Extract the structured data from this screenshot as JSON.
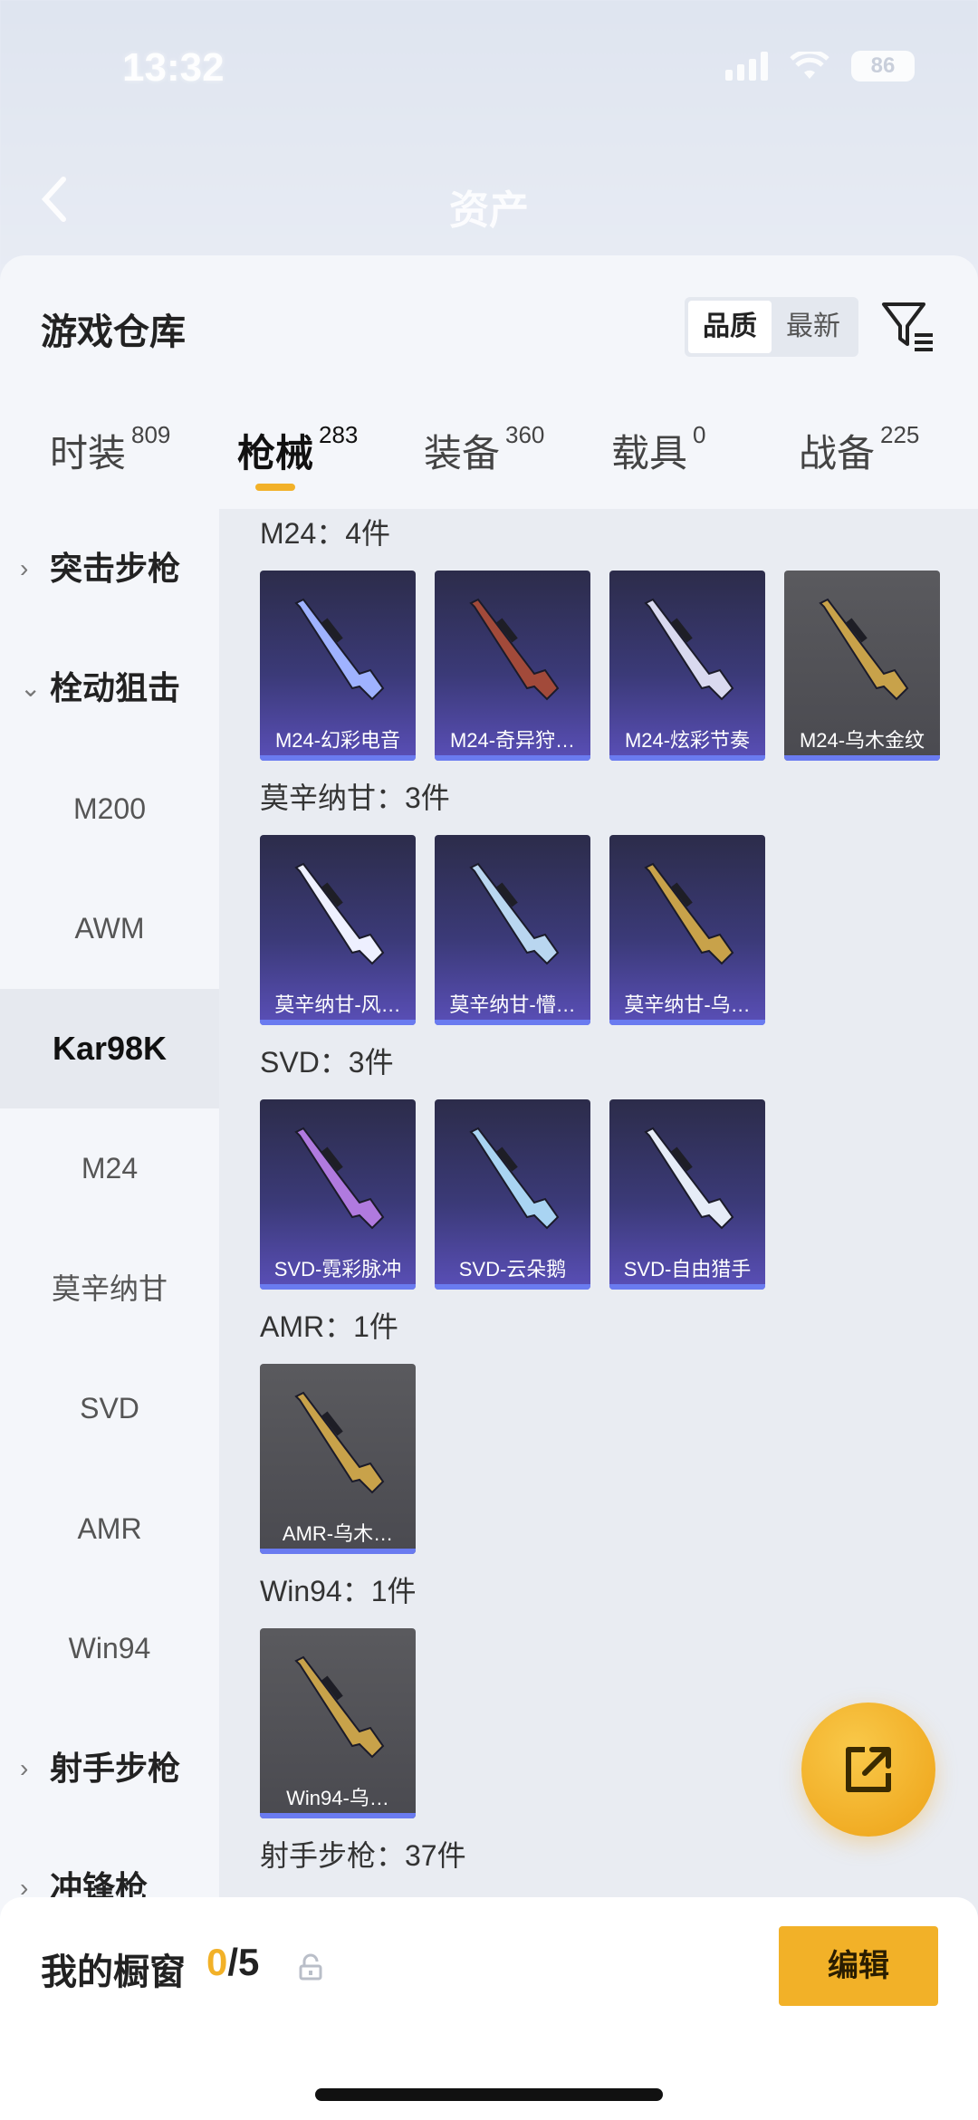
{
  "status": {
    "time": "13:32",
    "battery": "86"
  },
  "nav": {
    "title": "资产"
  },
  "sheet": {
    "title": "游戏仓库",
    "sort": {
      "options": [
        "品质",
        "最新"
      ],
      "active": "品质"
    }
  },
  "tabs": [
    {
      "label": "时装",
      "count": "809"
    },
    {
      "label": "枪械",
      "count": "283"
    },
    {
      "label": "装备",
      "count": "360"
    },
    {
      "label": "载具",
      "count": "0"
    },
    {
      "label": "战备",
      "count": "225"
    }
  ],
  "sidenav": {
    "items": [
      {
        "label": "突击步枪",
        "type": "group",
        "chev": "›"
      },
      {
        "label": "栓动狙击",
        "type": "group",
        "chev": "⌄"
      },
      {
        "label": "M200"
      },
      {
        "label": "AWM"
      },
      {
        "label": "Kar98K",
        "selected": true
      },
      {
        "label": "M24"
      },
      {
        "label": "莫辛纳甘"
      },
      {
        "label": "SVD"
      },
      {
        "label": "AMR"
      },
      {
        "label": "Win94"
      },
      {
        "label": "射手步枪",
        "type": "group",
        "chev": "›"
      },
      {
        "label": "冲锋枪",
        "type": "group",
        "chev": "›"
      }
    ]
  },
  "sections": [
    {
      "title": "M24：4件",
      "items": [
        {
          "name": "M24-幻彩电音",
          "style": "purple",
          "gun_color": "#9fb2ff"
        },
        {
          "name": "M24-奇异狩…",
          "style": "purple",
          "gun_color": "#a24a3a"
        },
        {
          "name": "M24-炫彩节奏",
          "style": "purple",
          "gun_color": "#d9d9ef"
        },
        {
          "name": "M24-乌木金纹",
          "style": "gray",
          "gun_color": "#c8a24a"
        }
      ]
    },
    {
      "title": "莫辛纳甘：3件",
      "items": [
        {
          "name": "莫辛纳甘-风…",
          "style": "purple",
          "gun_color": "#eef0ff"
        },
        {
          "name": "莫辛纳甘-懵…",
          "style": "purple",
          "gun_color": "#b9d6f0"
        },
        {
          "name": "莫辛纳甘-乌…",
          "style": "purple",
          "gun_color": "#c8a24a"
        }
      ]
    },
    {
      "title": "SVD：3件",
      "items": [
        {
          "name": "SVD-霓彩脉冲",
          "style": "purple",
          "gun_color": "#b07adf"
        },
        {
          "name": "SVD-云朵鹅",
          "style": "purple",
          "gun_color": "#a9d4f2"
        },
        {
          "name": "SVD-自由猎手",
          "style": "purple",
          "gun_color": "#e6ecf7"
        }
      ]
    },
    {
      "title": "AMR：1件",
      "items": [
        {
          "name": "AMR-乌木…",
          "style": "gray",
          "gun_color": "#c8a24a"
        }
      ]
    },
    {
      "title": "Win94：1件",
      "items": [
        {
          "name": "Win94-乌…",
          "style": "gray",
          "gun_color": "#c8a24a"
        }
      ]
    },
    {
      "title": "射手步枪：37件",
      "items": []
    }
  ],
  "bottom": {
    "label": "我的橱窗",
    "current": "0",
    "total": "/5",
    "edit": "编辑"
  },
  "colors": {
    "accent": "#f2b128",
    "card_purple": "#3b3a78",
    "card_gray": "#4a4a50",
    "rarity_bar": "#6a7bf0"
  }
}
